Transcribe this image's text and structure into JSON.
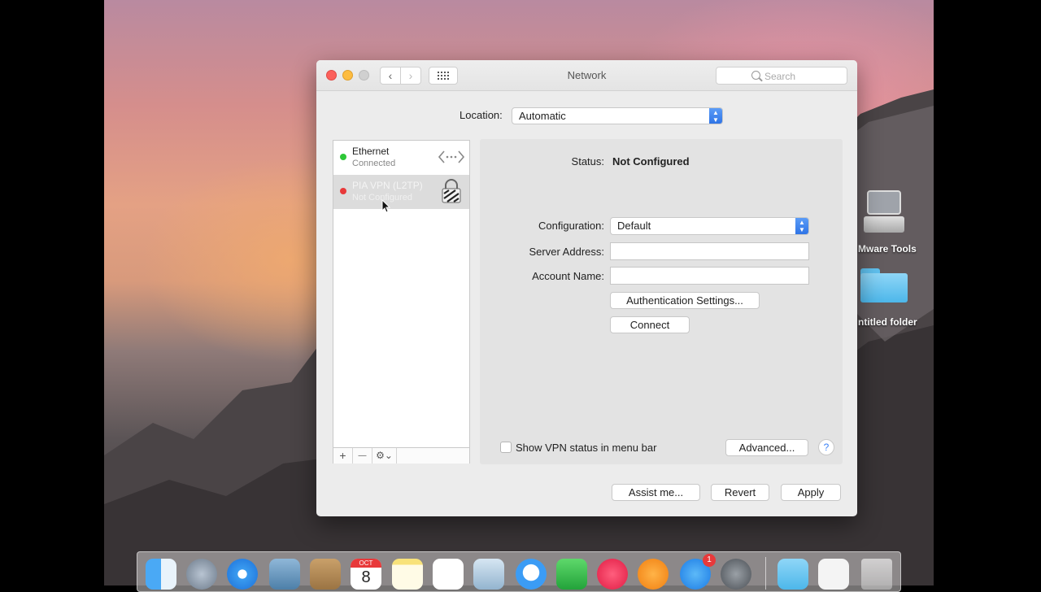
{
  "window": {
    "title": "Network",
    "search_placeholder": "Search",
    "nav_back": "‹",
    "nav_forward": "›"
  },
  "location": {
    "label": "Location:",
    "value": "Automatic"
  },
  "services": [
    {
      "name": "Ethernet",
      "status": "Connected",
      "dot_color": "#2dc737"
    },
    {
      "name": "PIA VPN (L2TP)",
      "status": "Not Configured",
      "dot_color": "#e8393a"
    }
  ],
  "sidebar_buttons": {
    "add": "+",
    "remove": "—",
    "action": "⚙⌄"
  },
  "detail": {
    "status_label": "Status:",
    "status_value": "Not Configured",
    "configuration_label": "Configuration:",
    "configuration_value": "Default",
    "server_address_label": "Server Address:",
    "server_address_value": "",
    "account_name_label": "Account Name:",
    "account_name_value": "",
    "auth_button": "Authentication Settings...",
    "connect_button": "Connect",
    "show_vpn_label": "Show VPN status in menu bar",
    "show_vpn_checked": false,
    "advanced_button": "Advanced...",
    "help_button": "?"
  },
  "footer": {
    "assist_button": "Assist me...",
    "revert_button": "Revert",
    "apply_button": "Apply"
  },
  "desktop_icons": [
    {
      "label": "Mware Tools"
    },
    {
      "label": "ntitled folder"
    }
  ],
  "dock": {
    "calendar_month": "OCT",
    "calendar_day": "8",
    "appstore_badge": "1"
  },
  "colors": {
    "accent": "#2f74e6",
    "close": "#fc605b",
    "minimize": "#fdbc40"
  }
}
